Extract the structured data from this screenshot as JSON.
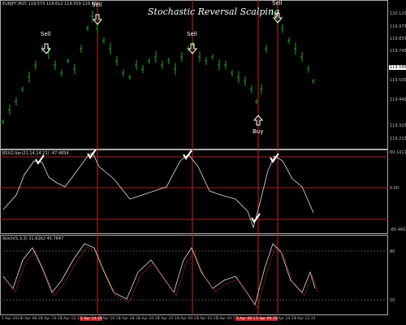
{
  "price_panel": {
    "header": "EURJPY,M15  119.573 119.612 119.559 119.585",
    "title": "Stochastic Reversal Scalping",
    "signals": [
      {
        "label": "Sell",
        "direction": "down"
      },
      {
        "label": "Sell",
        "direction": "down"
      },
      {
        "label": "Sell",
        "direction": "down"
      },
      {
        "label": "Sell",
        "direction": "down"
      },
      {
        "label": "Buy",
        "direction": "up"
      }
    ],
    "axis_labels": [
      "120.120",
      "119.975",
      "119.855",
      "119.745",
      "119.585",
      "119.530",
      "119.440",
      "119.320",
      "119.210"
    ],
    "current_price": "119.585"
  },
  "bsi_panel": {
    "header": "BSI(G-Var(21,14,14,21) -47.4854",
    "axis_labels": [
      "69.1411",
      "0.00",
      "-80.4603"
    ],
    "levels": [
      "50",
      "0",
      "-50"
    ]
  },
  "stoch_panel": {
    "header": "Stoch(5,3,3) 31.6262 45.7647",
    "axis_labels": [
      "80",
      "20"
    ]
  },
  "time_axis": [
    {
      "label": "1 Apr 2013",
      "highlight": false
    },
    {
      "label": "2 Apr 08:15",
      "highlight": false
    },
    {
      "label": "2 Apr 10:15",
      "highlight": false
    },
    {
      "label": "2 Apr 12:15",
      "highlight": false
    },
    {
      "label": "2 Apr 14:15",
      "highlight": true
    },
    {
      "label": "2 Apr 16:15",
      "highlight": false
    },
    {
      "label": "2 Apr 18:15",
      "highlight": false
    },
    {
      "label": "2 Apr 20:15",
      "highlight": false
    },
    {
      "label": "2 Apr 22:15",
      "highlight": false
    },
    {
      "label": "3 Apr 00:15",
      "highlight": false
    },
    {
      "label": "3 Apr 02:15",
      "highlight": false
    },
    {
      "label": "3 Apr 04:15",
      "highlight": false
    },
    {
      "label": "3 Apr 06:15",
      "highlight": true
    },
    {
      "label": "3 Apr 08:15",
      "highlight": true
    },
    {
      "label": "3 Apr 10:15",
      "highlight": false
    },
    {
      "label": "3 Apr 12:15",
      "highlight": false
    }
  ],
  "colors": {
    "bull_bar": "#22aa22",
    "signal_line": "#cc2222",
    "indicator_line": "#e0e0e0",
    "stoch_signal": "#cc3333",
    "level_line": "#aa2222"
  }
}
